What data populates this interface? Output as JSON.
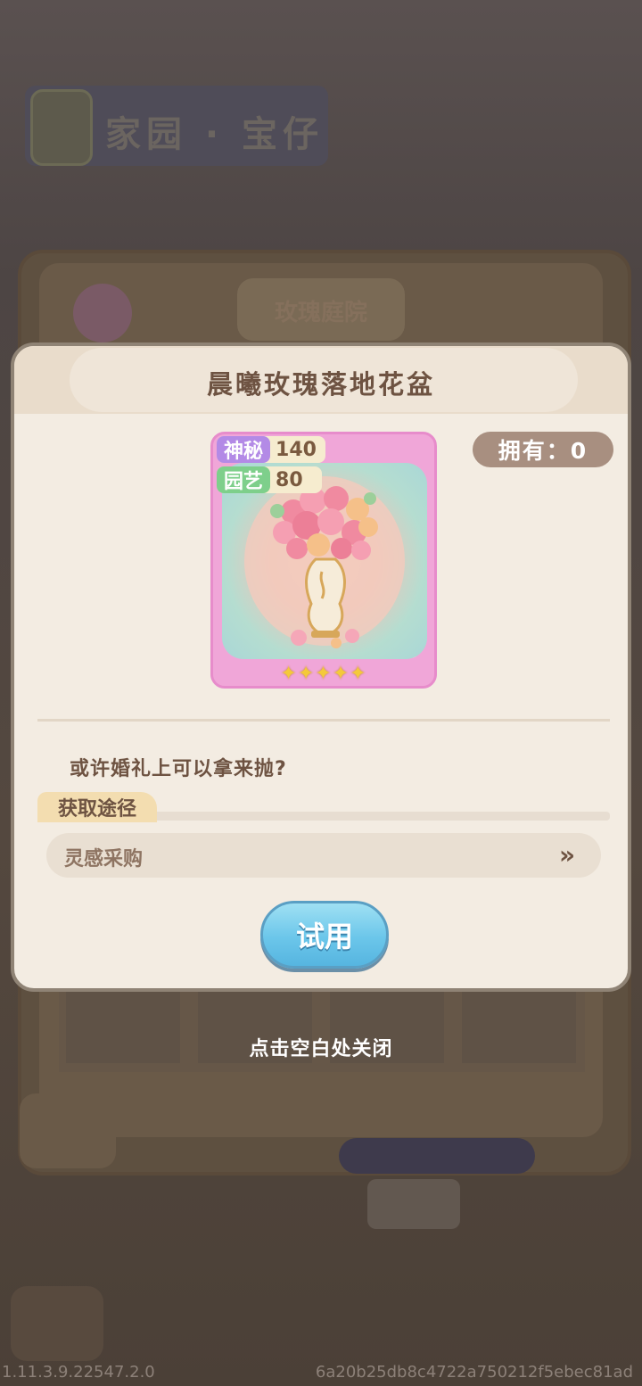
{
  "background": {
    "title": "家园 · 宝仔",
    "tab": "玫瑰庭院"
  },
  "dialog": {
    "title": "晨曦玫瑰落地花盆",
    "card": {
      "stat_mystery_label": "神秘",
      "stat_mystery_value": "140",
      "stat_garden_label": "园艺",
      "stat_garden_value": "80",
      "stars": "✦✦✦✦✦",
      "star_rating": 5,
      "owned_check_icon": "check-icon"
    },
    "owned_text": "拥有：0",
    "description": "或许婚礼上可以拿来抛?",
    "source_header": "获取途径",
    "source_item": "灵感采购",
    "source_arrow": "»",
    "try_button": "试用"
  },
  "close_hint": "点击空白处关闭",
  "footer": {
    "version": "1.11.3.9.22547.2.0",
    "hash": "6a20b25db8c4722a750212f5ebec81ad"
  },
  "colors": {
    "dialog_bg": "#f3ece2",
    "title_text": "#6e5342",
    "card_frame": "#f0a6d8",
    "try_button": "#6bc6ea",
    "mystery_tag": "#b38ae6",
    "garden_tag": "#7ecf8b"
  }
}
